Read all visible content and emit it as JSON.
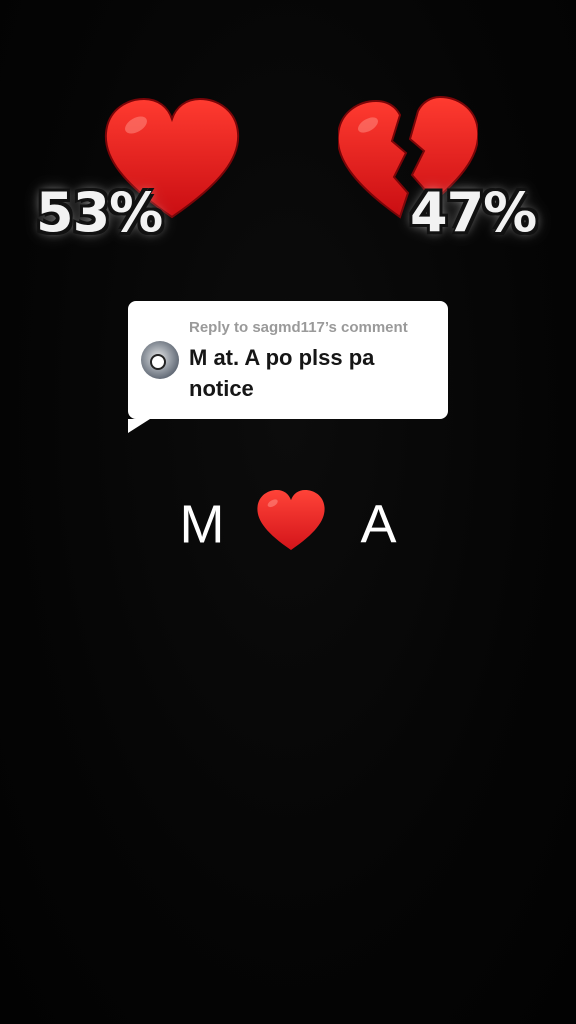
{
  "stats": {
    "love_percent": "53%",
    "heartbreak_percent": "47%"
  },
  "reply": {
    "label": "Reply to sagmd117’s comment",
    "text": "M at. A po plss pa notice"
  },
  "caption": {
    "left_letter": "M",
    "right_letter": "A"
  },
  "icons": {
    "love": "red-heart-icon",
    "heartbreak": "broken-heart-icon",
    "caption_heart": "red-heart-icon"
  },
  "colors": {
    "background": "#050505",
    "heart": "#e0151a",
    "card": "#ffffff"
  }
}
